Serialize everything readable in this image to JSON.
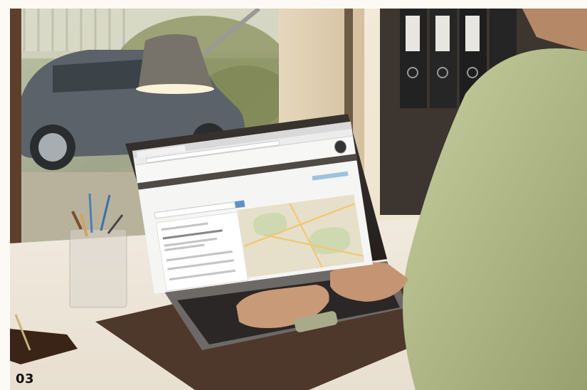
{
  "caption": {
    "number": "03"
  },
  "scene": {
    "description_visible": false,
    "colors": {
      "desk": "#f3ede3",
      "laptop_body": "#2b2624",
      "desk_pad": "#5a3e30",
      "shirt": "#b7c08f",
      "skin": "#c99a78",
      "car": "#5a6066"
    }
  },
  "icons": [
    "pen-holder-icon",
    "notebook-icon",
    "desk-lamp-icon",
    "binder-icon",
    "car-icon"
  ]
}
